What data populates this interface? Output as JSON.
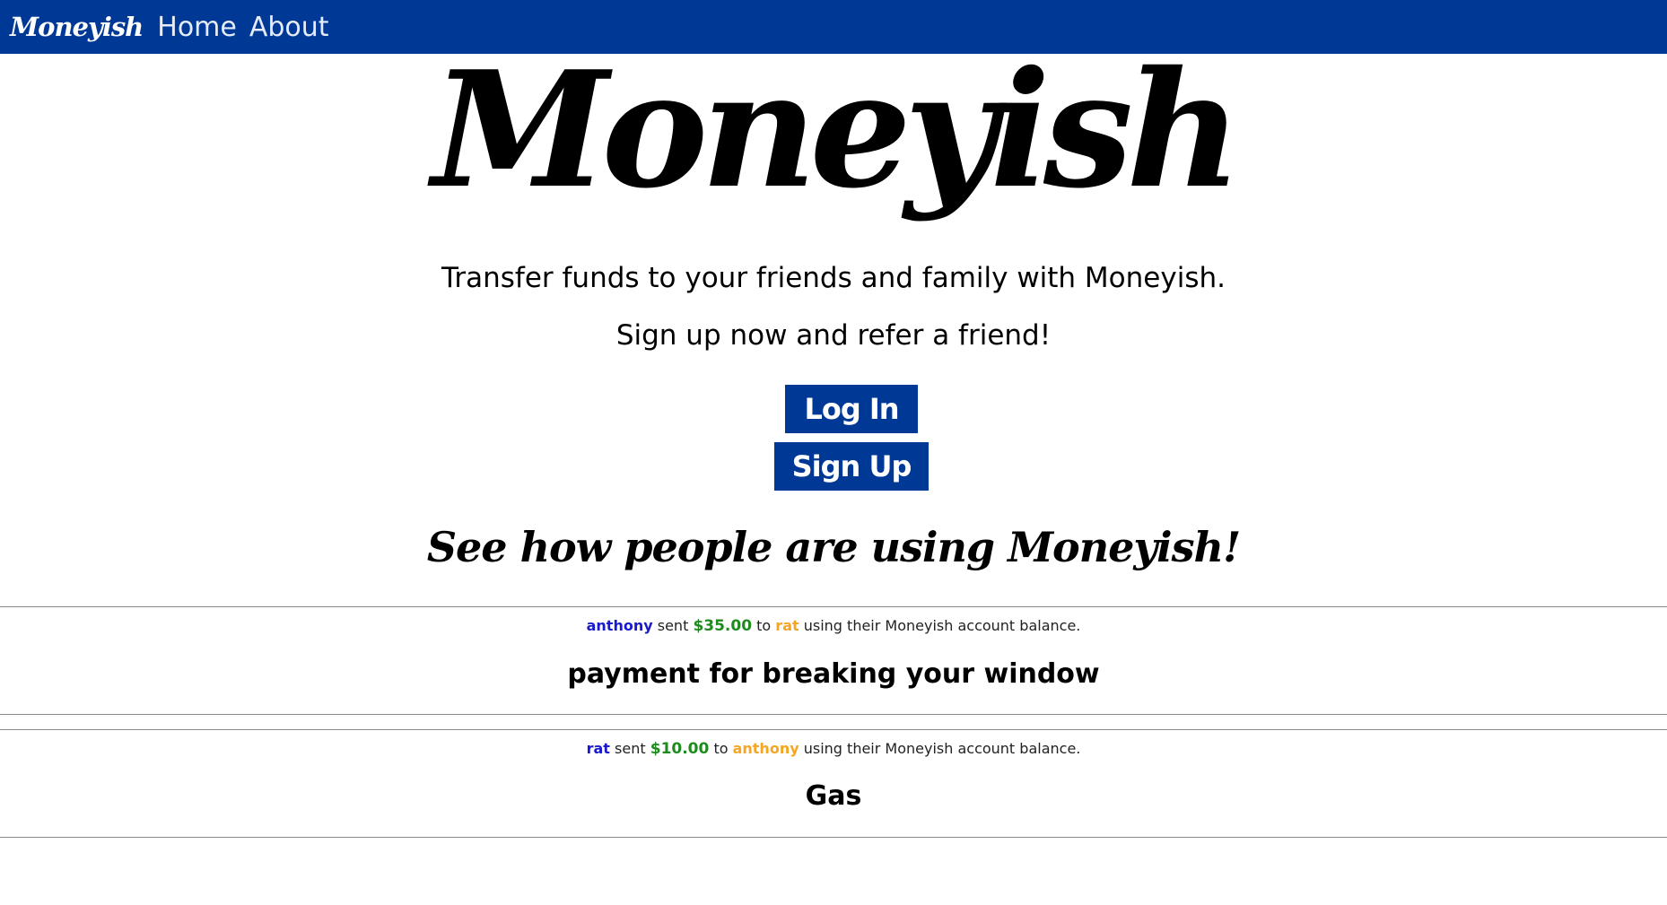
{
  "navbar": {
    "logo": "Moneyish",
    "links": [
      "Home",
      "About"
    ]
  },
  "hero": {
    "logo": "Moneyish",
    "tagline1": "Transfer funds to your friends and family with Moneyish.",
    "tagline2": "Sign up now and refer a friend!"
  },
  "buttons": {
    "login": "Log In",
    "signup": "Sign Up"
  },
  "feed": {
    "heading": "See how people are using Moneyish!",
    "transactions": [
      {
        "sender": "anthony",
        "verb": "sent",
        "amount": "$35.00",
        "to": "to",
        "recipient": "rat",
        "method": "using their Moneyish account balance.",
        "note": "payment for breaking your window"
      },
      {
        "sender": "rat",
        "verb": "sent",
        "amount": "$10.00",
        "to": "to",
        "recipient": "anthony",
        "method": "using their Moneyish account balance.",
        "note": "Gas"
      }
    ]
  },
  "colors": {
    "brand": "#003896",
    "sender": "#1a1acc",
    "amount": "#1f8a1f",
    "recipient": "#f5a623"
  }
}
